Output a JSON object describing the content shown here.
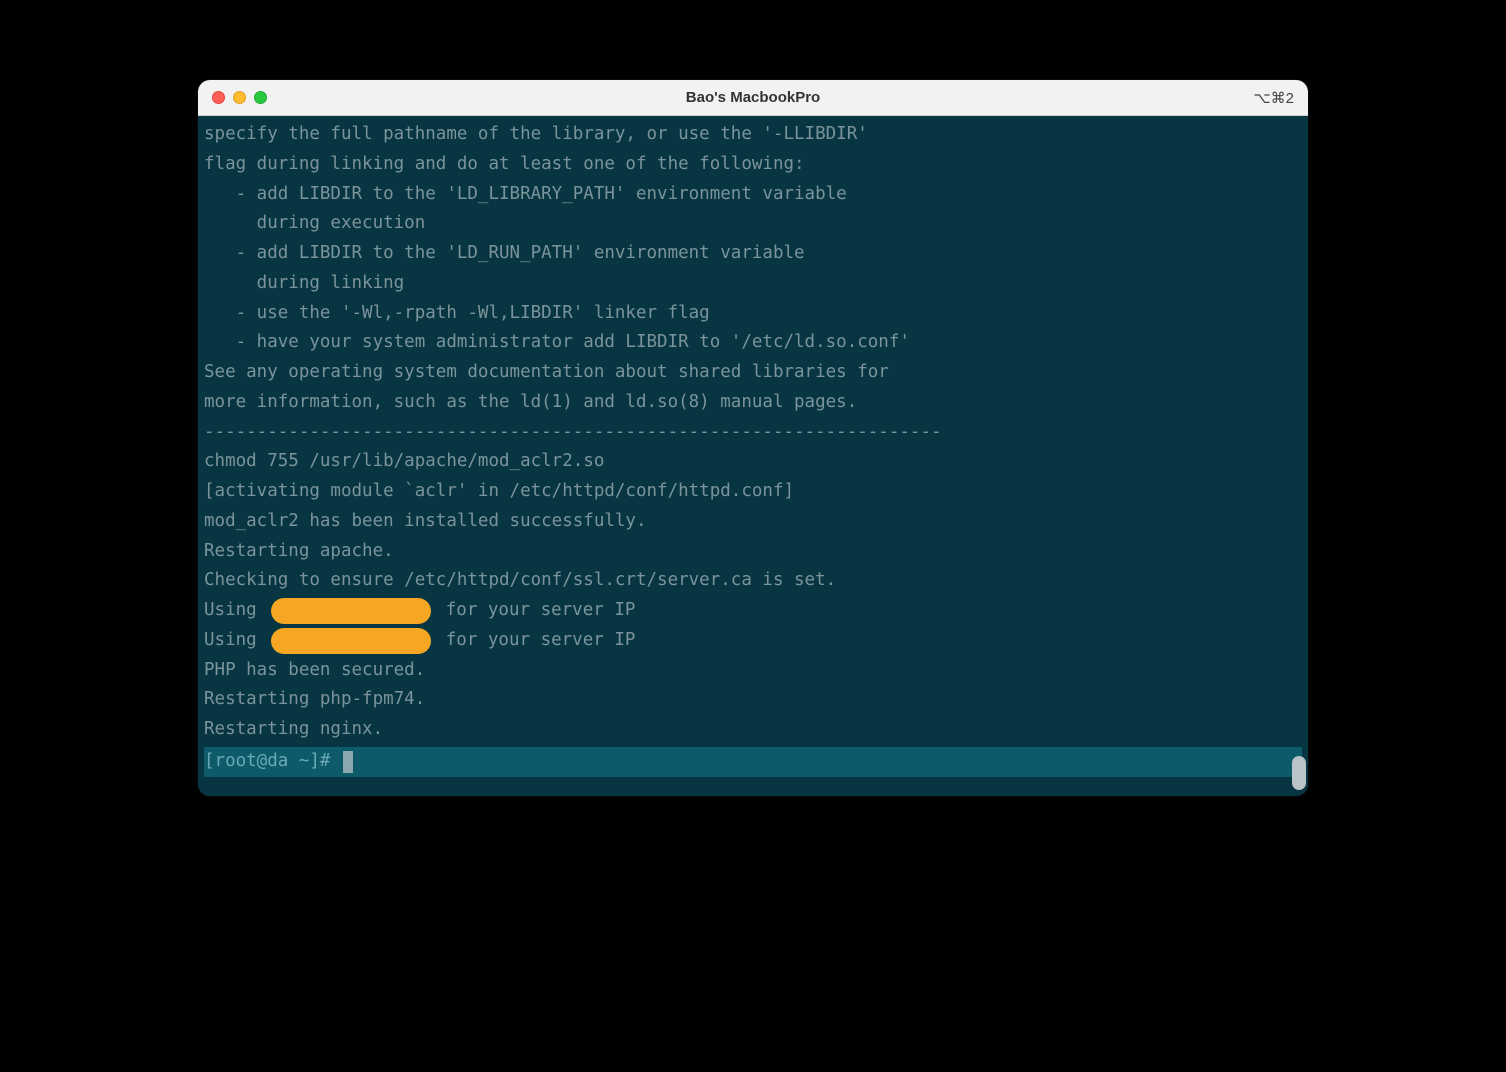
{
  "window": {
    "title": "Bao's MacbookPro",
    "shortcut": "⌥⌘2"
  },
  "terminal": {
    "lines": [
      "specify the full pathname of the library, or use the '-LLIBDIR'",
      "flag during linking and do at least one of the following:",
      "   - add LIBDIR to the 'LD_LIBRARY_PATH' environment variable",
      "     during execution",
      "   - add LIBDIR to the 'LD_RUN_PATH' environment variable",
      "     during linking",
      "   - use the '-Wl,-rpath -Wl,LIBDIR' linker flag",
      "   - have your system administrator add LIBDIR to '/etc/ld.so.conf'",
      "",
      "See any operating system documentation about shared libraries for",
      "more information, such as the ld(1) and ld.so(8) manual pages.",
      "----------------------------------------------------------------------",
      "chmod 755 /usr/lib/apache/mod_aclr2.so",
      "[activating module `aclr' in /etc/httpd/conf/httpd.conf]",
      "mod_aclr2 has been installed successfully.",
      "Restarting apache.",
      "Checking to ensure /etc/httpd/conf/ssl.crt/server.ca is set."
    ],
    "redacted": [
      {
        "prefix": "Using ",
        "suffix": " for your server IP"
      },
      {
        "prefix": "Using ",
        "suffix": " for your server IP"
      }
    ],
    "tail": [
      "PHP has been secured.",
      "Restarting php-fpm74.",
      "Restarting nginx."
    ],
    "prompt": "[root@da ~]# "
  }
}
